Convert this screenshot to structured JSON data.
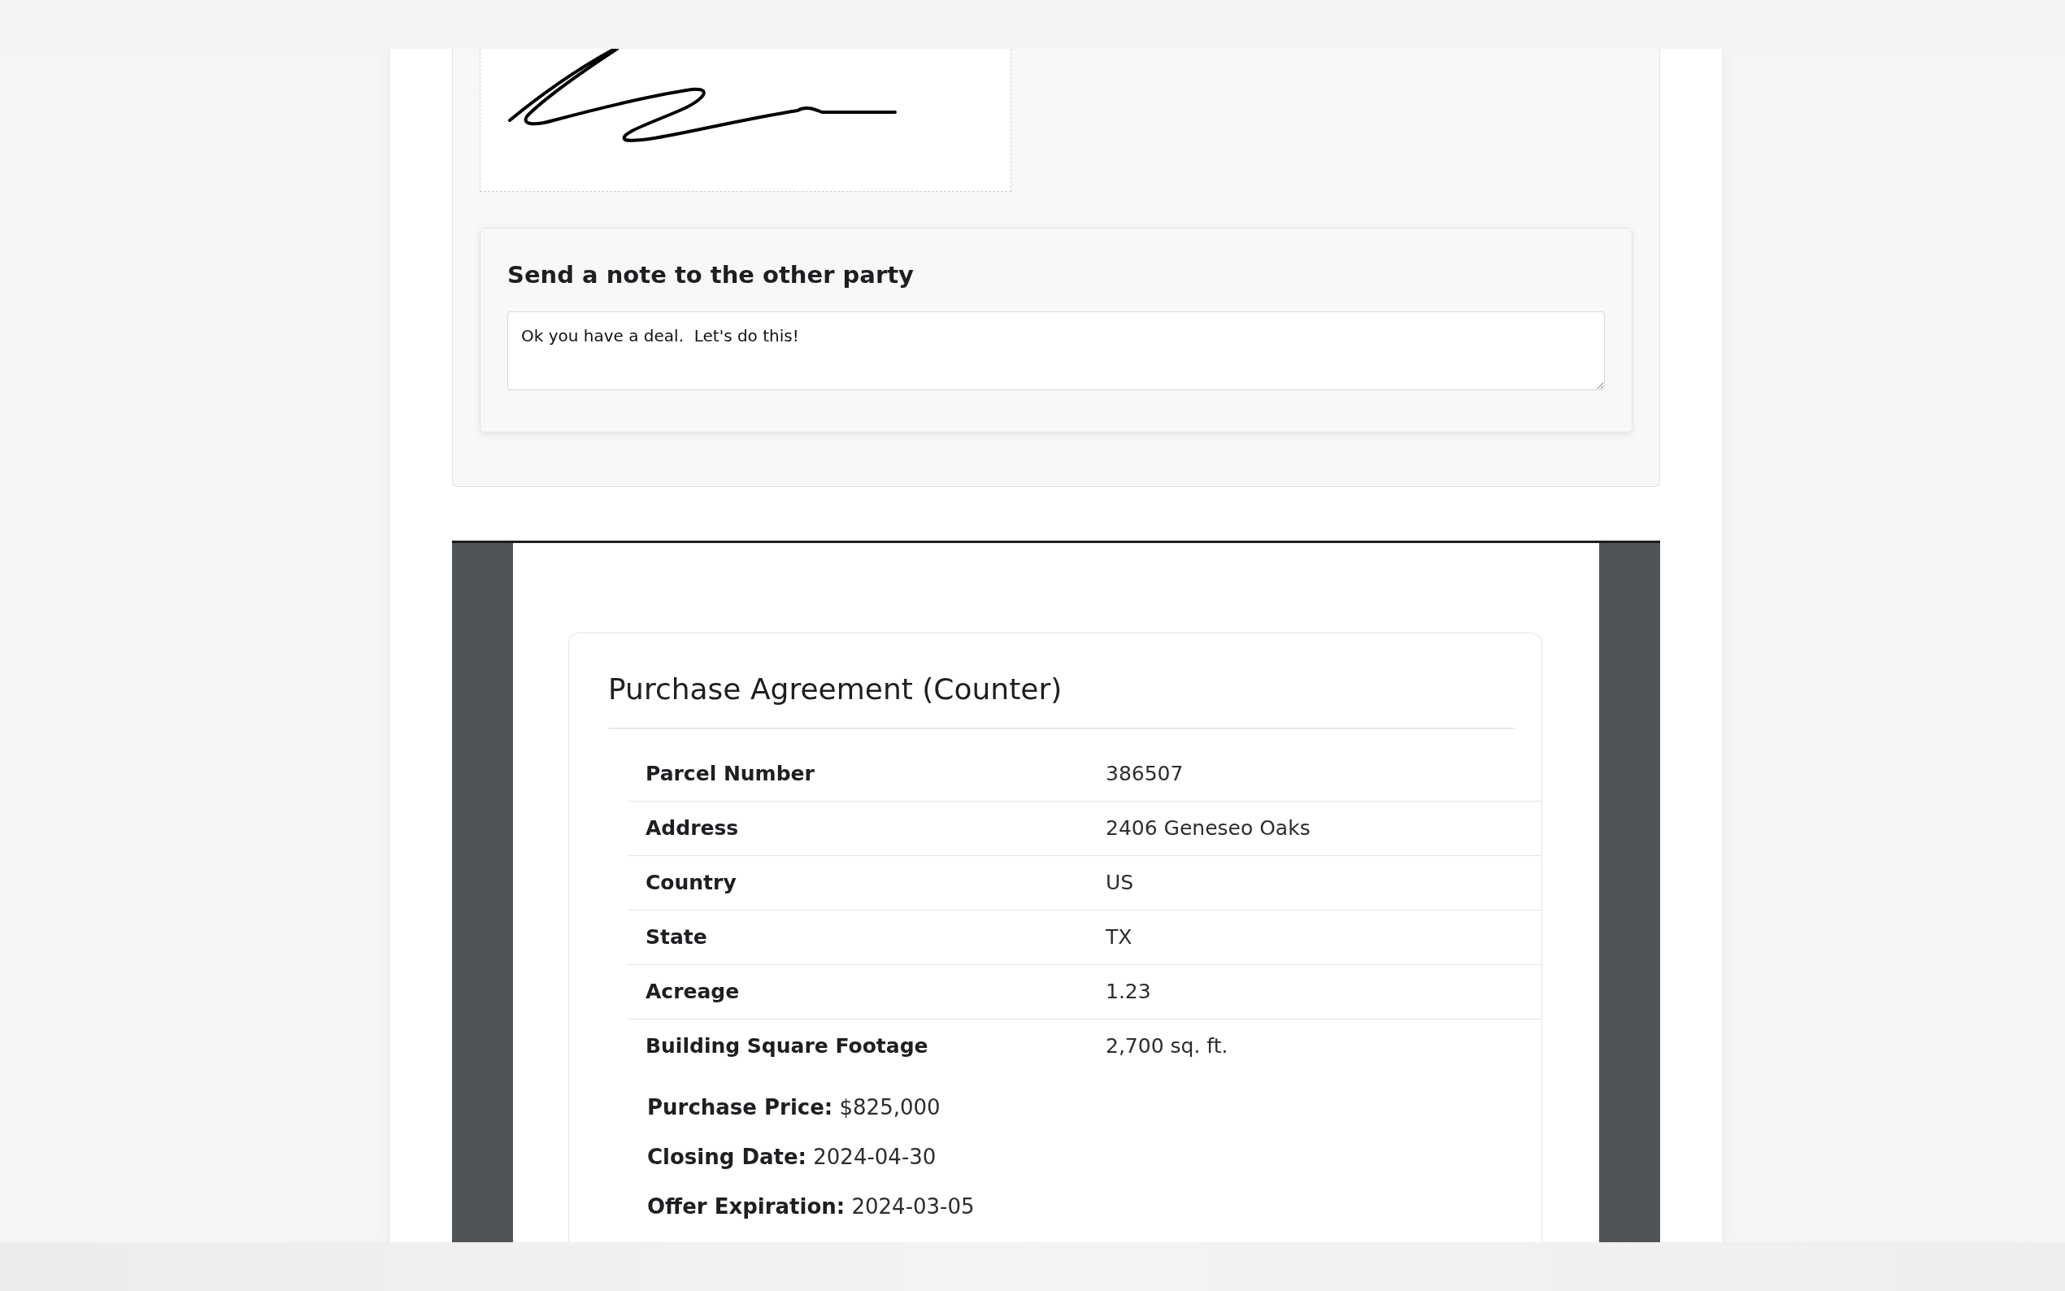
{
  "note": {
    "heading": "Send a note to the other party",
    "value": "Ok you have a deal.  Let's do this!"
  },
  "document": {
    "title": "Purchase Agreement (Counter)",
    "rows": [
      {
        "label": "Parcel Number",
        "value": "386507"
      },
      {
        "label": "Address",
        "value": "2406 Geneseo Oaks"
      },
      {
        "label": "Country",
        "value": "US"
      },
      {
        "label": "State",
        "value": "TX"
      },
      {
        "label": "Acreage",
        "value": "1.23"
      },
      {
        "label": "Building Square Footage",
        "value": "2,700 sq. ft."
      }
    ],
    "terms": [
      {
        "label": "Purchase Price:",
        "value": "$825,000"
      },
      {
        "label": "Closing Date:",
        "value": "2024-04-30"
      },
      {
        "label": "Offer Expiration:",
        "value": "2024-03-05"
      }
    ]
  }
}
